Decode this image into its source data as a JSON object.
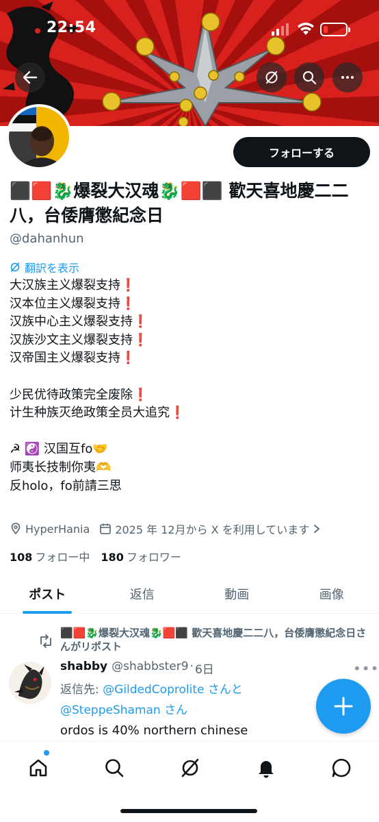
{
  "status_bar": {
    "time": "22:54"
  },
  "profile": {
    "display_name": "⬛🟥🐉爆裂大汉魂🐉🟥⬛ 歡天喜地慶二二八，台倭膺懲紀念日",
    "handle": "@dahanhun",
    "follow_label": "フォローする",
    "translate_label": "翻訳を表示",
    "bio": "大汉族主义爆裂支持❗\n汉本位主义爆裂支持❗\n汉族中心主义爆裂支持❗\n汉族沙文主义爆裂支持❗\n汉帝国主义爆裂支持❗\n\n少民优待政策完全废除❗\n计生种族灭绝政策全员大追究❗\n\n☭ ☯️ 汉国互fo🤝\n师夷长技制你夷🫶\n反holo，fo前請三思",
    "location": "HyperHania",
    "joined": "2025 年 12月から X を利用しています",
    "following_count": "108",
    "following_label": "フォロー中",
    "followers_count": "180",
    "followers_label": "フォロワー"
  },
  "tabs": [
    {
      "label": "ポスト",
      "active": true
    },
    {
      "label": "返信",
      "active": false
    },
    {
      "label": "動画",
      "active": false
    },
    {
      "label": "画像",
      "active": false
    }
  ],
  "post": {
    "repost_text": "⬛🟥🐉爆裂大汉魂🐉🟥⬛ 歡天喜地慶二二八，台倭膺懲紀念日さんがリポスト",
    "author_name": "shabby",
    "author_handle": "@shabbster9",
    "time": "6日",
    "separator": "·",
    "reply_prefix": "返信先: ",
    "reply_user1": "@GildedCoprolite",
    "reply_mid": " さんと",
    "reply_user2": "@SteppeShaman",
    "reply_suffix": " さん",
    "text": "ordos is 40% northern chinese"
  },
  "colors": {
    "accent": "#1d9bf0",
    "banner_red": "#d8201c",
    "text": "#0f1419",
    "muted": "#536471"
  },
  "icons": [
    "back-arrow-icon",
    "grok-icon",
    "search-icon",
    "more-icon",
    "location-icon",
    "calendar-icon",
    "chevron-right-icon",
    "repost-icon",
    "plus-icon",
    "home-icon",
    "notifications-icon",
    "messages-icon"
  ]
}
